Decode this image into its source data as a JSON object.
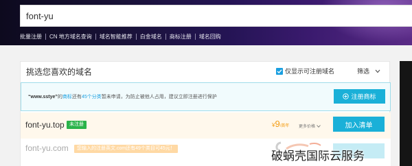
{
  "search": {
    "value": "font-yu"
  },
  "quick_links": [
    "批量注册",
    "CN 地方域名查询",
    "域名智能推荐",
    "白金域名",
    "商标注册",
    "域名回购"
  ],
  "card": {
    "title": "挑选您喜欢的域名",
    "only_available_label": "仅显示可注册域名",
    "only_available_checked": true,
    "filter_label": "筛选"
  },
  "notice": {
    "part1": "“www.sstye”",
    "part2": "的",
    "part3": "商标",
    "part4": "还有",
    "part5": "45个分类",
    "part6": "暂未申请，为防止被他人占用，建议立即注册进行保护",
    "button": "注册商标"
  },
  "results": [
    {
      "domain": "font-yu.top",
      "badge": "未注册",
      "price_symbol": "¥",
      "price": "9",
      "price_unit": "/首年",
      "more_price": "更多价格",
      "button": "加入清单"
    },
    {
      "domain": "font-yu.com",
      "badge": "您输入的注册英文.com还有49个类目可45元！"
    }
  ],
  "watermark": {
    "text": "破蜗壳国际云服务"
  },
  "colors": {
    "accent": "#1ab0d8",
    "available": "#2ab34a",
    "price": "#f39c12"
  }
}
